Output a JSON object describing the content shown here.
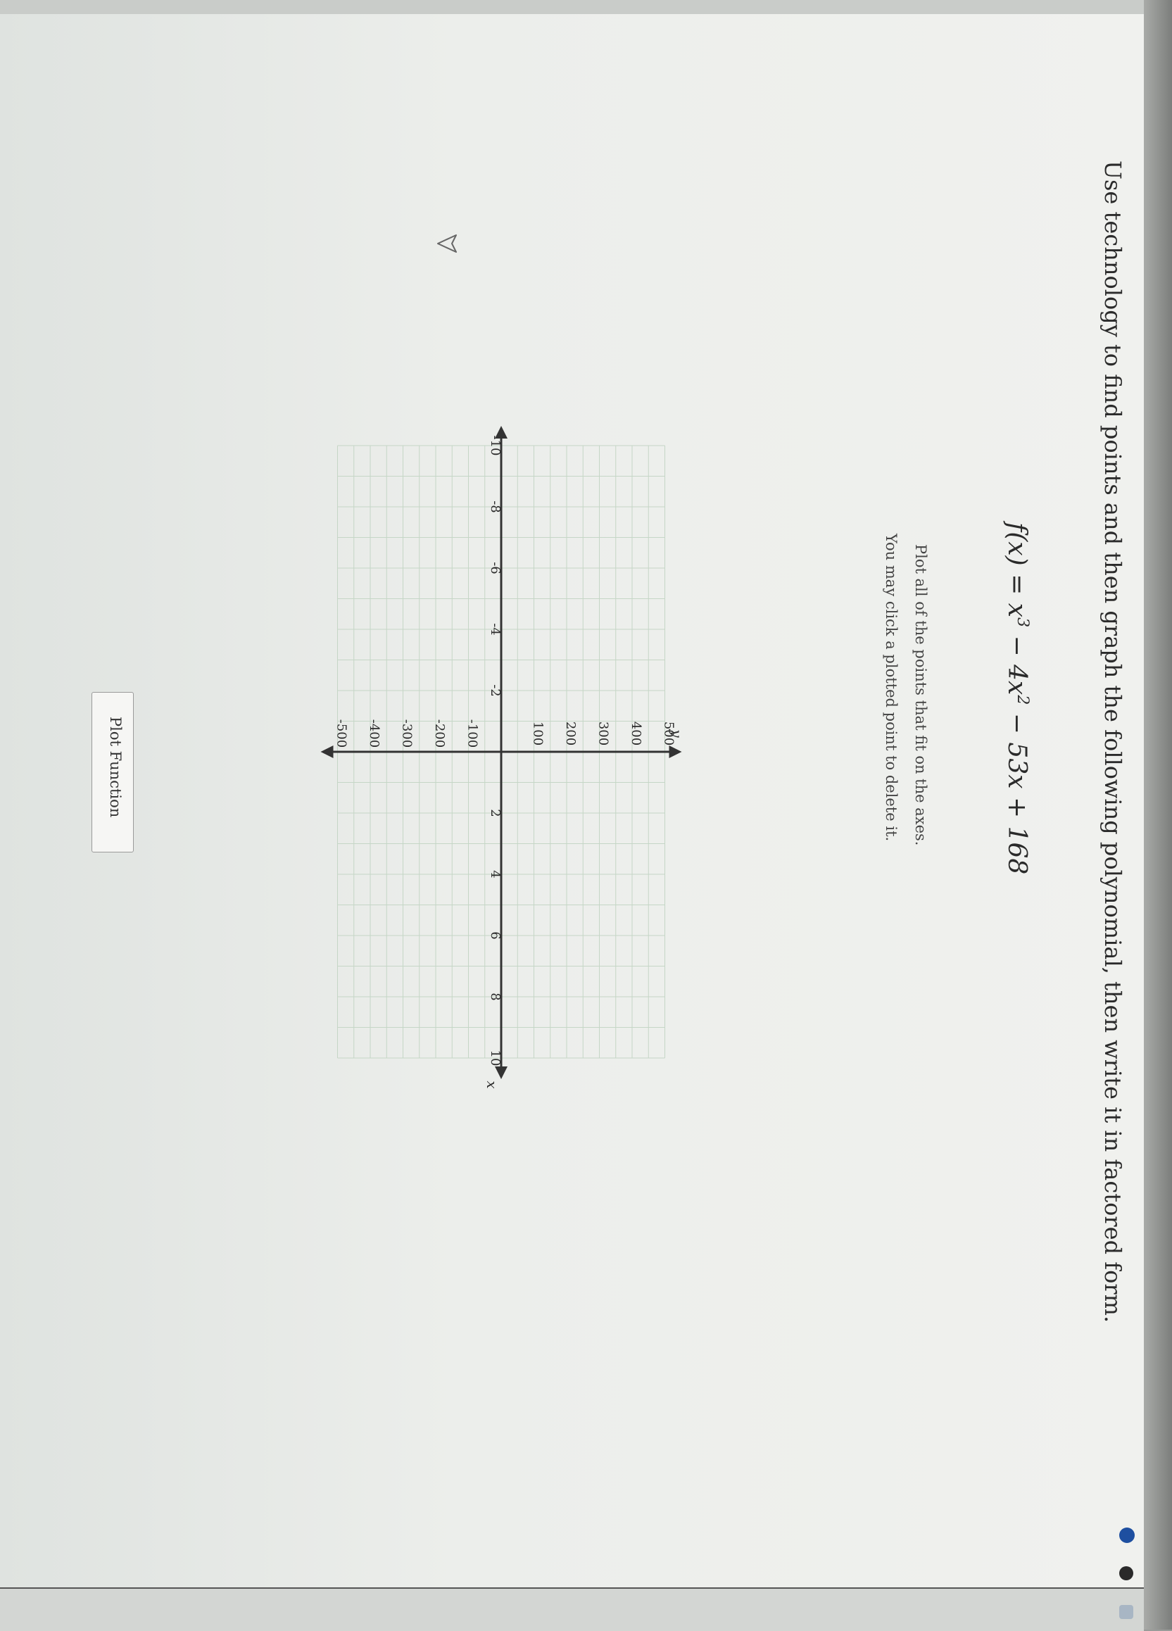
{
  "question": "Use technology to find points and then graph the following polynomial, then write it in factored form.",
  "formula": {
    "lhs": "f(x) = ",
    "t1": "x",
    "e1": "3",
    "t2": " − 4x",
    "e2": "2",
    "t3": " − 53x + 168"
  },
  "instructions": {
    "line1": "Plot all of the points that fit on the axes.",
    "line2": "You may click a plotted point to delete it."
  },
  "plot_button_label": "Plot Function",
  "chart_data": {
    "type": "scatter",
    "title": "",
    "xlabel": "x",
    "ylabel": "y",
    "xlim": [
      -10,
      10
    ],
    "ylim": [
      -500,
      500
    ],
    "x_ticks": [
      -10,
      -8,
      -6,
      -4,
      -2,
      2,
      4,
      6,
      8,
      10
    ],
    "y_ticks": [
      -500,
      -400,
      -300,
      -200,
      -100,
      100,
      200,
      300,
      400,
      500
    ],
    "x_tick_labels": [
      "-10",
      "-8",
      "-6",
      "-4",
      "-2",
      "2",
      "4",
      "6",
      "8",
      "10"
    ],
    "y_tick_labels": [
      "-500",
      "-400",
      "-300",
      "-200",
      "-100",
      "100",
      "200",
      "300",
      "400",
      "500"
    ],
    "grid": true,
    "series": []
  },
  "colors": {
    "grid": "#c5d6c6",
    "axis": "#333333",
    "text": "#2b2b2b"
  },
  "icons": {
    "cursor": "pointer-arrow-icon",
    "taskbar": [
      "taskbar-app-icon",
      "taskbar-app-icon",
      "taskbar-app-icon"
    ]
  }
}
